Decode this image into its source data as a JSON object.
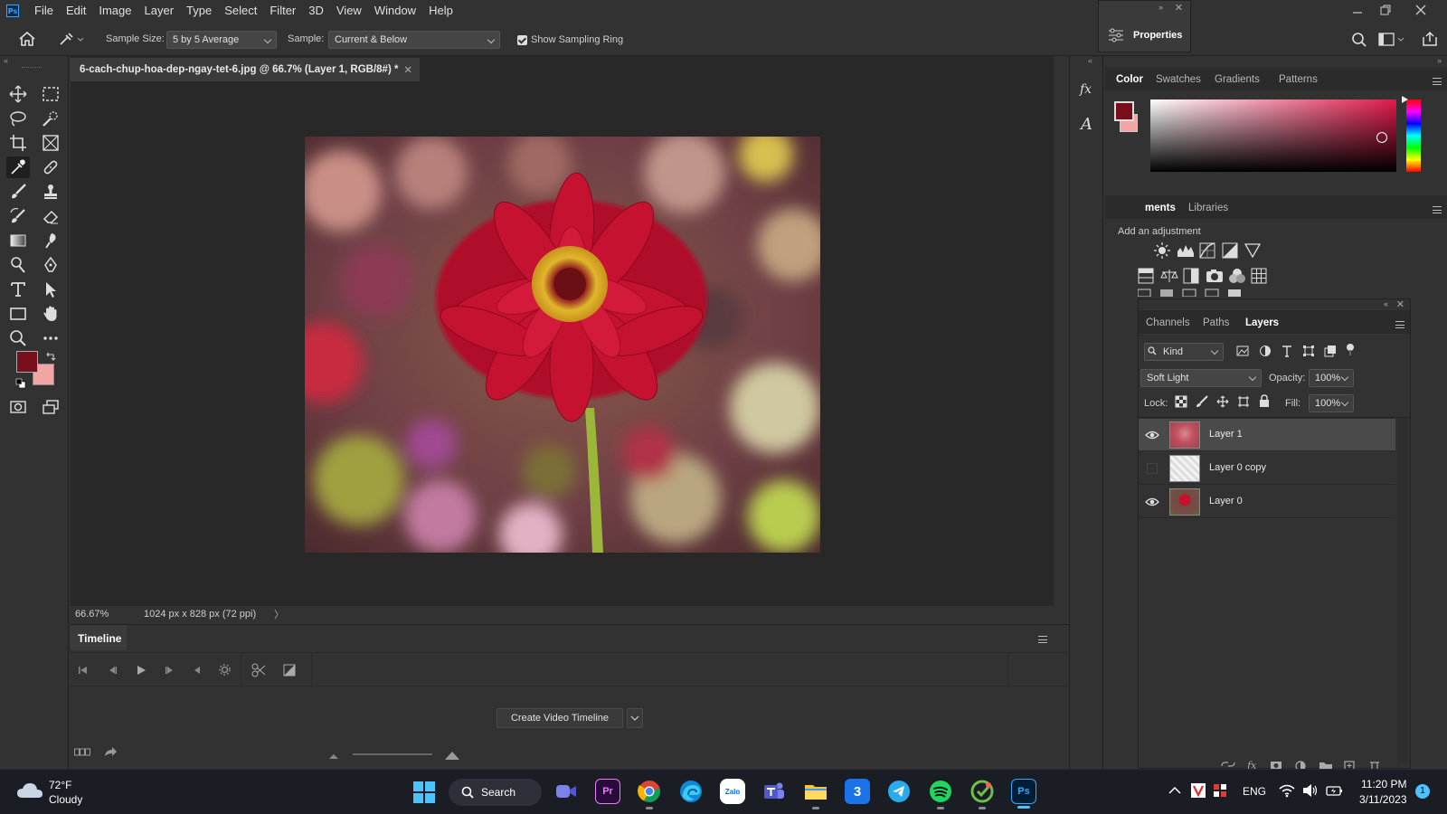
{
  "app": {
    "logo_text": "Ps",
    "menu": [
      "File",
      "Edit",
      "Image",
      "Layer",
      "Type",
      "Select",
      "Filter",
      "3D",
      "View",
      "Window",
      "Help"
    ]
  },
  "options_bar": {
    "sample_size_label": "Sample Size:",
    "sample_size_value": "5 by 5 Average",
    "sample_label": "Sample:",
    "sample_value": "Current & Below",
    "show_ring_label": "Show Sampling Ring",
    "show_ring_checked": true
  },
  "properties_popup": {
    "label": "Properties"
  },
  "document": {
    "tab_title": "6-cach-chup-hoa-dep-ngay-tet-6.jpg @ 66.7% (Layer 1, RGB/8#) *",
    "zoom": "66.67%",
    "dimensions": "1024 px x 828 px (72 ppi)"
  },
  "colors": {
    "foreground": "#7a0f1c",
    "background": "#f2a6a4",
    "accent": "#31a8ff"
  },
  "timeline": {
    "tab_label": "Timeline",
    "create_button": "Create Video Timeline"
  },
  "color_panel": {
    "tabs": [
      "Color",
      "Swatches",
      "Gradients",
      "Patterns"
    ],
    "active_tab": "Color"
  },
  "adjustments_panel": {
    "tabs": [
      "ments",
      "Libraries"
    ],
    "hint": "Add an adjustment"
  },
  "layers_panel": {
    "tabs": [
      "Channels",
      "Paths",
      "Layers"
    ],
    "active_tab": "Layers",
    "filter_kind": "Kind",
    "blend_mode": "Soft Light",
    "opacity_label": "Opacity:",
    "opacity_value": "100%",
    "lock_label": "Lock:",
    "fill_label": "Fill:",
    "fill_value": "100%",
    "layers": [
      {
        "name": "Layer 1",
        "visible": true,
        "selected": true
      },
      {
        "name": "Layer 0 copy",
        "visible": false,
        "selected": false
      },
      {
        "name": "Layer 0",
        "visible": true,
        "selected": false
      }
    ]
  },
  "taskbar": {
    "weather_temp": "72°F",
    "weather_desc": "Cloudy",
    "search_label": "Search",
    "apps": [
      "meet",
      "premiere-pro",
      "chrome",
      "edge",
      "zalo",
      "teams",
      "file-explorer",
      "3",
      "telegram",
      "spotify",
      "tick",
      "photoshop"
    ],
    "premiere_label": "Pr",
    "zalo_label": "Zalo",
    "app3_label": "3",
    "photoshop_label": "Ps",
    "language": "ENG",
    "time": "11:20 PM",
    "date": "3/11/2023",
    "notification_count": "1"
  }
}
